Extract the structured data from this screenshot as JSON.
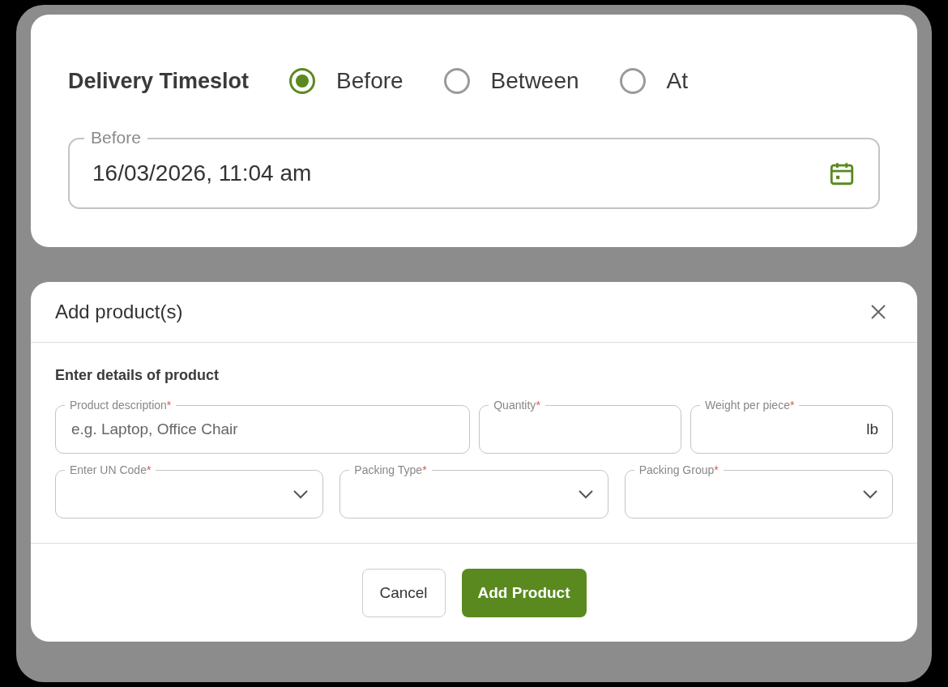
{
  "timeslot": {
    "label": "Delivery Timeslot",
    "options": [
      {
        "label": "Before",
        "selected": true
      },
      {
        "label": "Between",
        "selected": false
      },
      {
        "label": "At",
        "selected": false
      }
    ],
    "field": {
      "label": "Before",
      "value": "16/03/2026, 11:04 am"
    }
  },
  "dialog": {
    "title": "Add product(s)",
    "section": "Enter details of product",
    "rows": [
      [
        {
          "kind": "text",
          "label": "Product description",
          "mark": "*",
          "placeholder": "e.g. Laptop, Office Chair"
        },
        {
          "kind": "text",
          "label": "Quantity",
          "mark": "*"
        },
        {
          "kind": "text",
          "label": "Weight per piece",
          "mark": "*",
          "suffix": "lb"
        }
      ],
      [
        {
          "kind": "select",
          "label": "Enter UN Code",
          "mark": "*"
        },
        {
          "kind": "select",
          "label": "Packing Type",
          "mark": "*"
        },
        {
          "kind": "select",
          "label": "Packing Group",
          "mark": "*"
        }
      ]
    ],
    "buttons": [
      {
        "kind": "secondary",
        "label": "Cancel"
      },
      {
        "kind": "primary",
        "label": "Add Product"
      }
    ]
  }
}
